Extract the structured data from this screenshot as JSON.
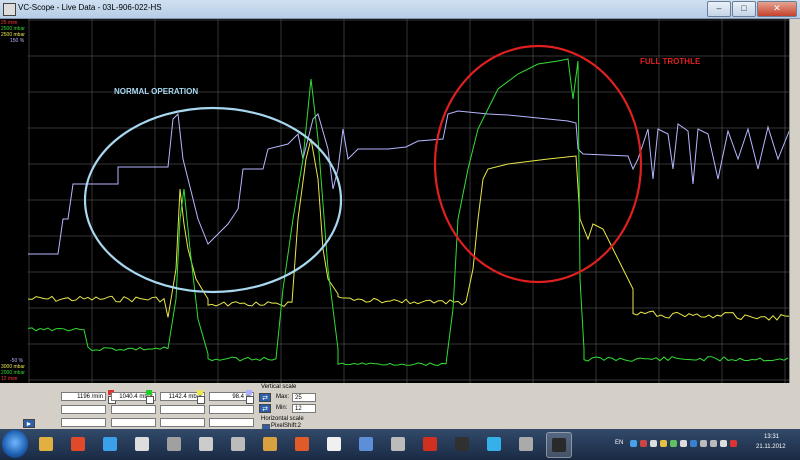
{
  "window": {
    "title": "VC-Scope - Live Data - 03L-906-022-HS"
  },
  "left_scale": {
    "top": [
      {
        "text": "25 /min",
        "color": "#ff3b3b"
      },
      {
        "text": "2500 mbar",
        "color": "#33dd33"
      },
      {
        "text": "2500 mbar",
        "color": "#e8e84a"
      },
      {
        "text": "150 %",
        "color": "#b6b6ff"
      }
    ],
    "bottom": [
      {
        "text": "-50 %",
        "color": "#b6b6ff"
      },
      {
        "text": "3000 mbar",
        "color": "#e8e84a"
      },
      {
        "text": "2000 mbar",
        "color": "#33dd33"
      },
      {
        "text": "12 /min",
        "color": "#ff3b3b"
      }
    ]
  },
  "annotations": {
    "normal": {
      "text": "NORMAL OPERATION",
      "color": "#a8d8f0"
    },
    "full": {
      "text": "FULL TROTHLE",
      "color": "#e02020"
    }
  },
  "readouts": [
    {
      "value": "1196 /min",
      "color": "#e03030"
    },
    {
      "value": "1040.4 mbar",
      "color": "#22cc22"
    },
    {
      "value": "1142.4 mbar",
      "color": "#e8e84a"
    },
    {
      "value": "98.4 %",
      "color": "#aab0ff"
    }
  ],
  "vertical_scale": {
    "label": "Vertical scale",
    "max_label": "Max:",
    "max_value": "25",
    "min_label": "Min:",
    "min_value": "12"
  },
  "horizontal_scale": {
    "label": "Horizontal scale",
    "option": "PixelShift:2"
  },
  "tray": {
    "lang": "EN",
    "time": "13:31",
    "date": "21.11.2012"
  },
  "taskbar": {
    "icons": [
      "start-orb",
      "file-icon",
      "explorer-folder-icon",
      "chrome-icon",
      "internet-explorer-icon",
      "calculator-icon",
      "media-icon",
      "scanner-icon",
      "tools-icon",
      "paint-icon",
      "mail-icon",
      "monitor-icon",
      "network-icon",
      "acrobat-icon",
      "terminal-icon",
      "skype-icon",
      "diagnostic-icon",
      "vcscope-icon"
    ]
  },
  "colors": {
    "rpm": "#ff3b3b",
    "boost": "#33dd33",
    "pressure": "#e8e84a",
    "load": "#b6b6ff",
    "grid": "#666666"
  }
}
